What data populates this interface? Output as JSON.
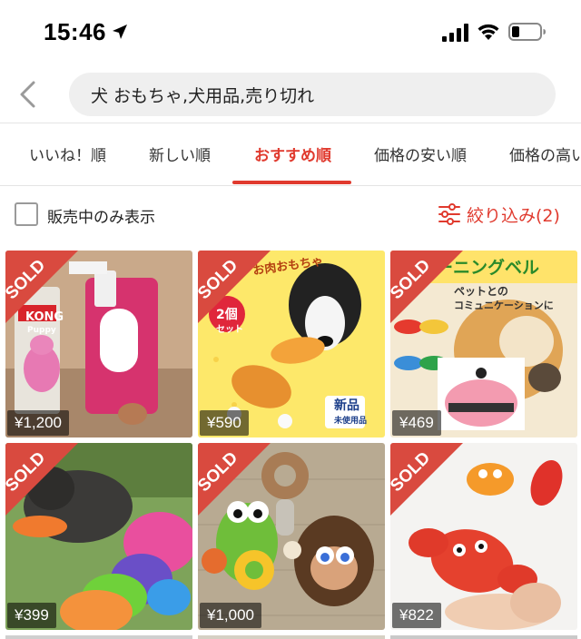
{
  "status_bar": {
    "time": "15:46",
    "icons": [
      "location-arrow-icon",
      "cellular-signal-icon",
      "wifi-icon",
      "battery-icon"
    ]
  },
  "header": {
    "back_icon": "chevron-left-icon",
    "search_value": "犬 おもちゃ,犬用品,売り切れ"
  },
  "tabs": [
    {
      "label": "いいね！順",
      "active": false
    },
    {
      "label": "新しい順",
      "active": false
    },
    {
      "label": "おすすめ順",
      "active": true
    },
    {
      "label": "価格の安い順",
      "active": false
    },
    {
      "label": "価格の高い",
      "active": false
    }
  ],
  "filter": {
    "checkbox_label": "販売中のみ表示",
    "checkbox_checked": false,
    "filter_label": "絞り込み(2)",
    "filter_icon": "sliders-icon"
  },
  "products": [
    {
      "price": "¥1,200",
      "status": "SOLD",
      "tags": [
        "KONG",
        "Puppy"
      ]
    },
    {
      "price": "¥590",
      "status": "SOLD",
      "tags": [
        "お肉おもちゃ",
        "2個",
        "セット",
        "新品",
        "未使用品"
      ]
    },
    {
      "price": "¥469",
      "status": "SOLD",
      "tags": [
        "ーニングベル",
        "ペットとの",
        "コミュニケーションに"
      ]
    },
    {
      "price": "¥399",
      "status": "SOLD",
      "tags": []
    },
    {
      "price": "¥1,000",
      "status": "SOLD",
      "tags": []
    },
    {
      "price": "¥822",
      "status": "SOLD",
      "tags": []
    }
  ],
  "colors": {
    "accent": "#e03a2e",
    "ribbon": "#d94a3f",
    "search_bg": "#efefef"
  }
}
